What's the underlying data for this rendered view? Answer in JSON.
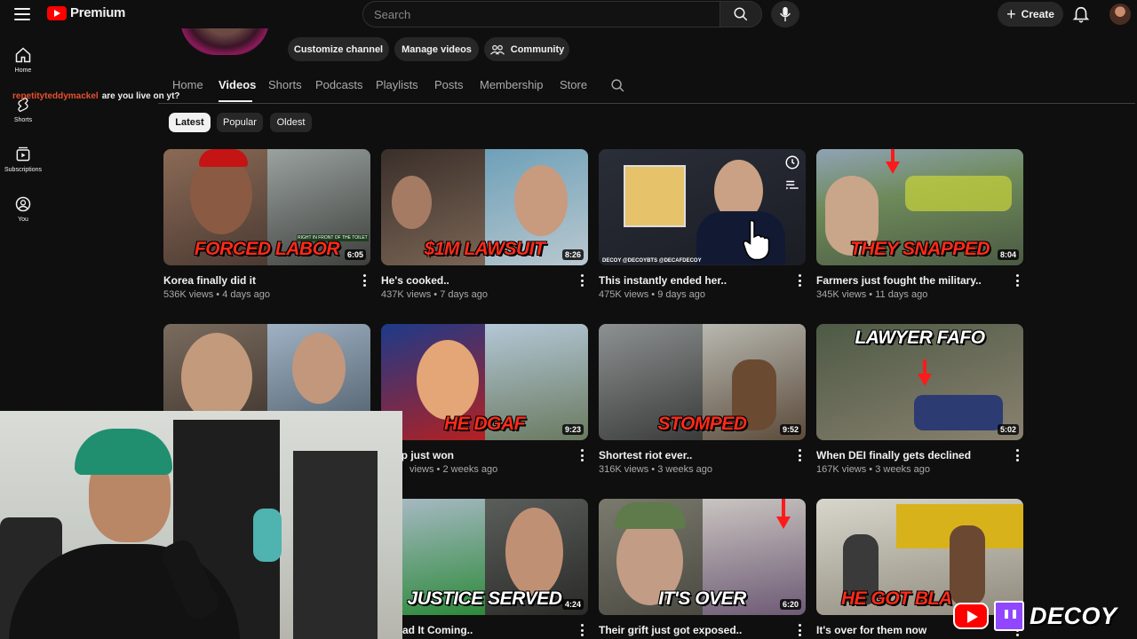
{
  "header": {
    "logo_text": "Premium",
    "search_placeholder": "Search",
    "create_label": "Create"
  },
  "rail": {
    "items": [
      {
        "label": "Home",
        "icon": "home-icon"
      },
      {
        "label": "Shorts",
        "icon": "shorts-icon"
      },
      {
        "label": "Subscriptions",
        "icon": "subscriptions-icon"
      },
      {
        "label": "You",
        "icon": "you-icon"
      }
    ]
  },
  "channel": {
    "buttons": [
      "Customize channel",
      "Manage videos",
      "Community"
    ],
    "tabs": [
      "Home",
      "Videos",
      "Shorts",
      "Podcasts",
      "Playlists",
      "Posts",
      "Membership",
      "Store"
    ],
    "active_tab": "Videos"
  },
  "chat": {
    "user": "repetityteddymackel",
    "message": "are you live on yt?"
  },
  "filters": {
    "chips": [
      "Latest",
      "Popular",
      "Oldest"
    ],
    "active": "Latest"
  },
  "videos": [
    {
      "title": "Korea finally did it",
      "meta": "536K views • 4 days ago",
      "duration": "6:05",
      "overlay": "FORCED LABOR"
    },
    {
      "title": "He's cooked..",
      "meta": "437K views • 7 days ago",
      "duration": "8:26",
      "overlay": "$1M LAWSUIT"
    },
    {
      "title": "This instantly ended her..",
      "meta": "475K views • 9 days ago",
      "duration": "",
      "overlay": ""
    },
    {
      "title": "Farmers just fought the military..",
      "meta": "345K views • 11 days ago",
      "duration": "8:04",
      "overlay": "THEY SNAPPED"
    },
    {
      "title": "",
      "meta": "",
      "duration": "",
      "overlay": ""
    },
    {
      "title": "mp just won",
      "meta": "views • 2 weeks ago",
      "duration": "9:23",
      "overlay": "HE DGAF"
    },
    {
      "title": "Shortest riot ever..",
      "meta": "316K views • 3 weeks ago",
      "duration": "9:52",
      "overlay": "STOMPED"
    },
    {
      "title": "When DEI finally gets declined",
      "meta": "167K views • 3 weeks ago",
      "duration": "5:02",
      "overlay": "LAWYER FAFO"
    },
    {
      "title": "",
      "meta": "",
      "duration": "",
      "overlay": ""
    },
    {
      "title": "ad It Coming..",
      "meta": "",
      "duration": "4:24",
      "overlay": "JUSTICE SERVED"
    },
    {
      "title": "Their grift just got exposed..",
      "meta": "",
      "duration": "6:20",
      "overlay": "IT'S OVER"
    },
    {
      "title": "It's over for them now",
      "meta": "",
      "duration": "",
      "overlay": "HE GOT BLA"
    }
  ],
  "thumb_small_text": {
    "v1": "RIGHT IN FRONT OF THE TOILET",
    "v3": "DECOY  @DECOYBTS  @DECAFDECOY"
  },
  "brand": {
    "name": "DECOY"
  },
  "colors": {
    "background": "#0f0f0f",
    "accent_red": "#ff0000",
    "overlay_red": "#ff2a1a",
    "twitch_purple": "#9146ff",
    "chat_user": "#e8502f"
  }
}
